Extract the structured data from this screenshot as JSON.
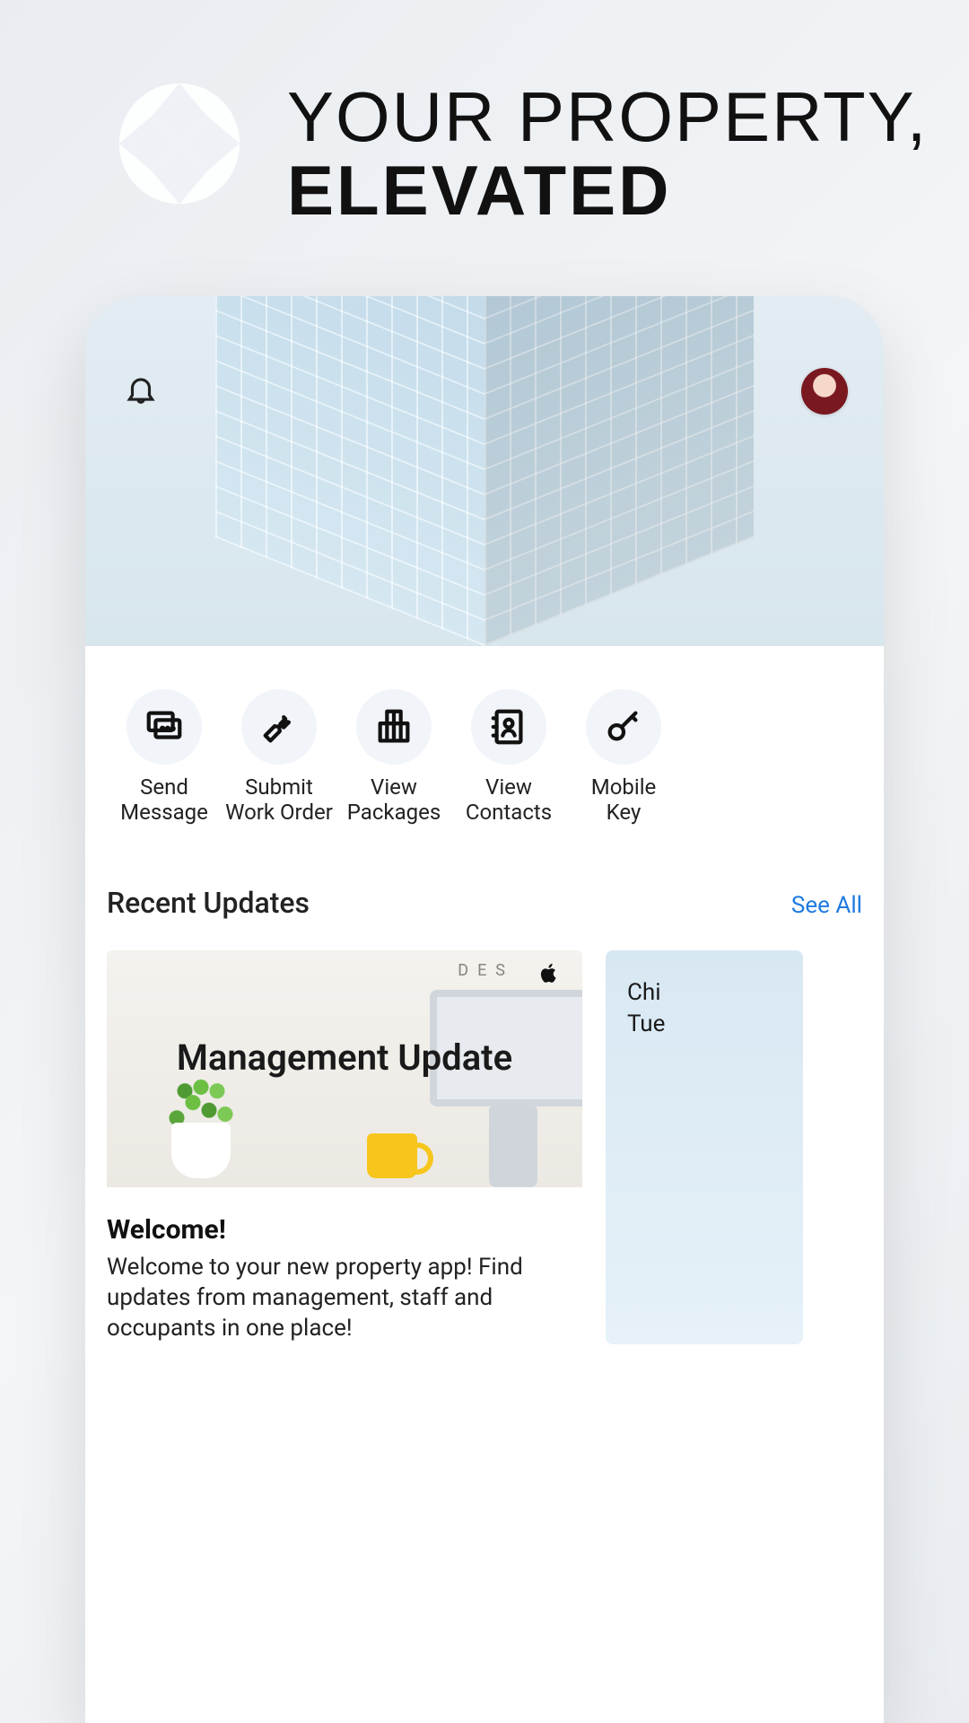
{
  "marketing": {
    "tagline_line1": "YOUR PROPERTY,",
    "tagline_line2": "ELEVATED"
  },
  "top_bar": {
    "notifications_icon": "bell-icon",
    "avatar_icon": "avatar"
  },
  "quick_actions": [
    {
      "id": "send-message",
      "label_line1": "Send",
      "label_line2": "Message",
      "icon": "chat-icon"
    },
    {
      "id": "submit-work",
      "label_line1": "Submit",
      "label_line2": "Work Order",
      "icon": "wrench-icon"
    },
    {
      "id": "view-packages",
      "label_line1": "View",
      "label_line2": "Packages",
      "icon": "packages-icon"
    },
    {
      "id": "view-contacts",
      "label_line1": "View",
      "label_line2": "Contacts",
      "icon": "contacts-icon"
    },
    {
      "id": "mobile-key",
      "label_line1": "Mobile",
      "label_line2": "Key",
      "icon": "key-icon"
    }
  ],
  "updates": {
    "section_title": "Recent Updates",
    "see_all_label": "See All",
    "cards": [
      {
        "overlay_title": "Management Update",
        "desk_text": "DES",
        "title": "Welcome!",
        "body": "Welcome to your new property app! Find updates from management, staff and occupants in one place!"
      },
      {
        "peek_line1": "Chi",
        "peek_line2": "Tue"
      }
    ]
  },
  "colors": {
    "accent_link": "#1f7ae0",
    "qa_circle_bg": "#f1f4f9"
  }
}
